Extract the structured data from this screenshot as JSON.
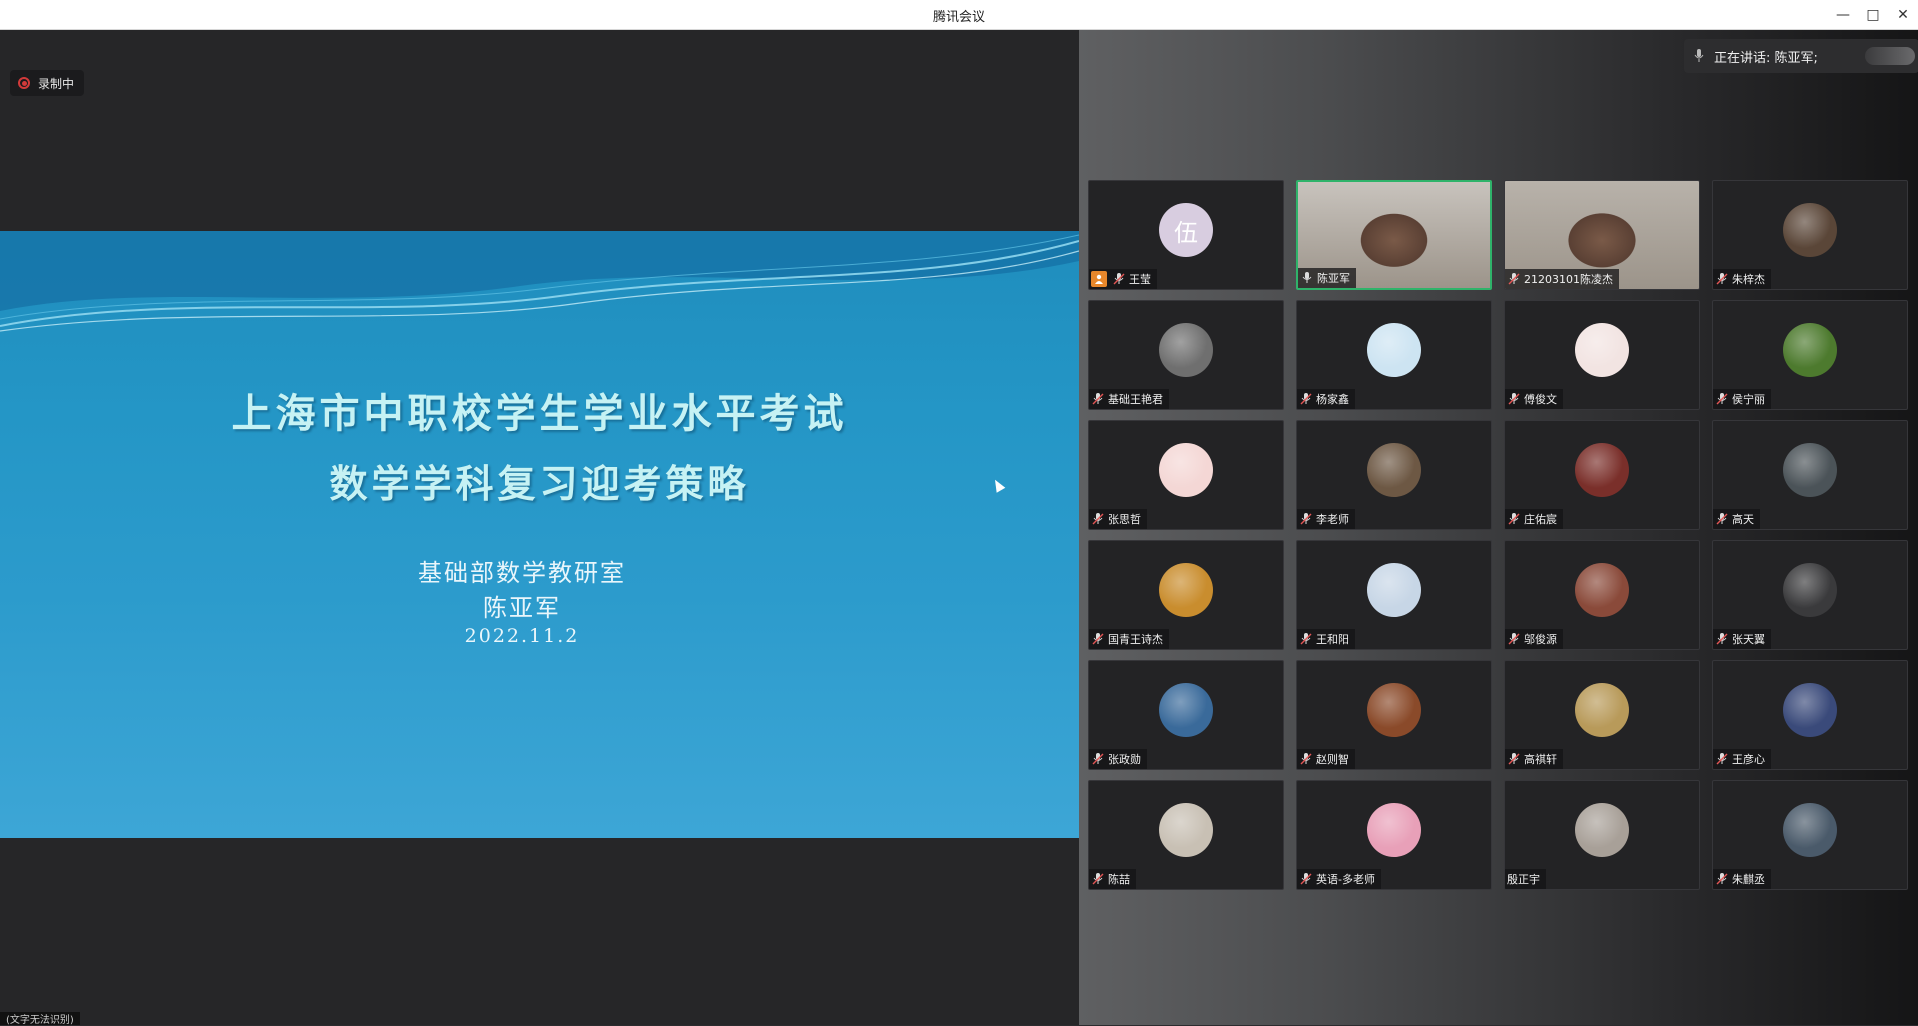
{
  "window": {
    "title": "腾讯会议",
    "controls": {
      "minimize_icon": "minimize-icon",
      "maximize_icon": "maximize-icon",
      "close_icon": "close-icon"
    }
  },
  "recording": {
    "label": "录制中",
    "color": "#d23a3a"
  },
  "slide": {
    "title_line1": "上海市中职校学生学业水平考试",
    "title_line2": "数学学科复习迎考策略",
    "dept": "基础部数学教研室",
    "author": "陈亚军",
    "date": "2022.11.2"
  },
  "speaking": {
    "label": "正在讲话: 陈亚军;"
  },
  "share_hint": {
    "label": "(文字无法识别)"
  },
  "colors": {
    "active_border": "#2fb36a",
    "host_badge": "#e7872b",
    "slide_title": "#c6f2f4"
  },
  "participants": [
    {
      "name": "王莹",
      "avatar": "伍",
      "kind": "letter",
      "color": "#d8cde0",
      "host": true,
      "mic": "muted"
    },
    {
      "name": "陈亚军",
      "kind": "video",
      "color": "#c8c3bd",
      "active": true,
      "mic": "on"
    },
    {
      "name": "21203101陈凌杰",
      "kind": "video",
      "color": "#b8b2aa",
      "mic": "muted"
    },
    {
      "name": "朱梓杰",
      "kind": "image",
      "color": "#5a4638",
      "mic": "muted"
    },
    {
      "name": "基础王艳君",
      "kind": "image",
      "color": "#6f6f6f",
      "mic": "muted"
    },
    {
      "name": "杨家鑫",
      "kind": "image",
      "color": "#cde4f2",
      "mic": "muted"
    },
    {
      "name": "傅俊文",
      "kind": "image",
      "color": "#f2e4e2",
      "mic": "muted"
    },
    {
      "name": "侯宁丽",
      "kind": "image",
      "color": "#4d7a2e",
      "mic": "muted"
    },
    {
      "name": "张思哲",
      "kind": "image",
      "color": "#f4d7d5",
      "mic": "muted"
    },
    {
      "name": "李老师",
      "kind": "image",
      "color": "#6d5844",
      "mic": "muted"
    },
    {
      "name": "庄佑宸",
      "kind": "image",
      "color": "#7a2f2a",
      "mic": "muted"
    },
    {
      "name": "高天",
      "kind": "image",
      "color": "#4b5358",
      "mic": "muted"
    },
    {
      "name": "国青王诗杰",
      "kind": "image",
      "color": "#c98d2e",
      "mic": "muted"
    },
    {
      "name": "王和阳",
      "kind": "image",
      "color": "#c7d6e6",
      "mic": "muted"
    },
    {
      "name": "邬俊源",
      "kind": "image",
      "color": "#8a4a3a",
      "mic": "muted"
    },
    {
      "name": "张天翼",
      "kind": "image",
      "color": "#3a3a3c",
      "mic": "muted"
    },
    {
      "name": "张政勋",
      "kind": "image",
      "color": "#3a6a9a",
      "mic": "muted"
    },
    {
      "name": "赵则智",
      "kind": "image",
      "color": "#8a4a2a",
      "mic": "muted"
    },
    {
      "name": "高祺轩",
      "kind": "image",
      "color": "#b89a5a",
      "mic": "muted"
    },
    {
      "name": "王彦心",
      "kind": "image",
      "color": "#3a4a7a",
      "mic": "muted"
    },
    {
      "name": "陈喆",
      "kind": "image",
      "color": "#c8c0b4",
      "mic": "muted"
    },
    {
      "name": "英语-多老师",
      "kind": "image",
      "color": "#e8a0b8",
      "mic": "muted"
    },
    {
      "name": "殷正宇",
      "kind": "image",
      "color": "#a8a098",
      "mic": "none"
    },
    {
      "name": "朱麒丞",
      "kind": "image",
      "color": "#4a5a6a",
      "mic": "muted"
    }
  ]
}
